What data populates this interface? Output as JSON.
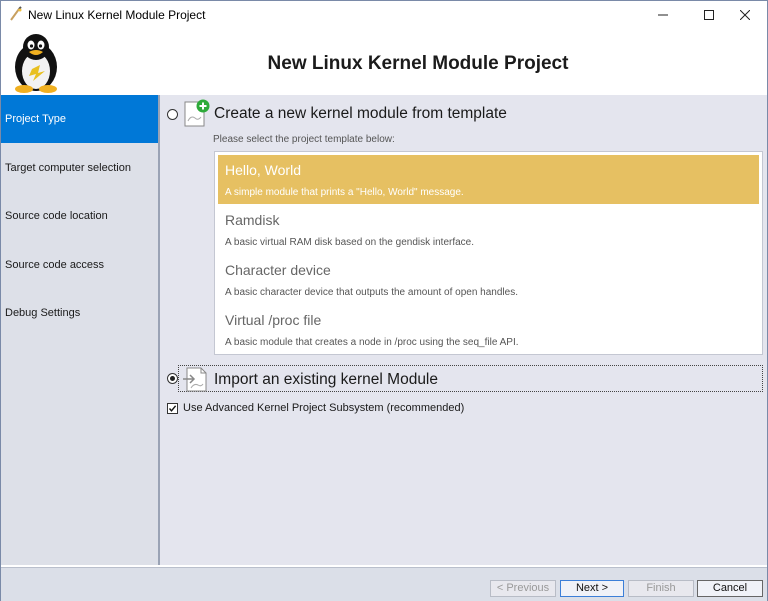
{
  "window": {
    "title": "New Linux Kernel Module Project"
  },
  "header": {
    "heading": "New Linux Kernel Module Project"
  },
  "sidebar": {
    "items": [
      {
        "label": "Project Type",
        "active": true
      },
      {
        "label": "Target computer selection"
      },
      {
        "label": "Source code location"
      },
      {
        "label": "Source code access"
      },
      {
        "label": "Debug Settings"
      }
    ]
  },
  "main": {
    "option_template": {
      "label": "Create a new kernel module from template",
      "selected": false
    },
    "hint": "Please select the project template below:",
    "templates": [
      {
        "title": "Hello, World",
        "description": "A simple module that prints a \"Hello, World\" message.",
        "selected": true
      },
      {
        "title": "Ramdisk",
        "description": "A basic virtual RAM disk based on the gendisk interface."
      },
      {
        "title": "Character device",
        "description": "A basic character device that outputs the amount of open handles."
      },
      {
        "title": "Virtual /proc file",
        "description": "A basic module that creates a node in /proc using the seq_file API."
      }
    ],
    "option_import": {
      "label": "Import an existing kernel Module",
      "selected": true
    },
    "advanced_checkbox": {
      "label": "Use Advanced Kernel Project Subsystem (recommended)",
      "checked": true
    }
  },
  "footer": {
    "previous_label": "< Previous",
    "next_label": "Next >",
    "finish_label": "Finish",
    "cancel_label": "Cancel"
  },
  "colors": {
    "sidebar_active": "#0078d7",
    "template_selected": "#e6c062",
    "main_bg": "#e4e5ee"
  }
}
